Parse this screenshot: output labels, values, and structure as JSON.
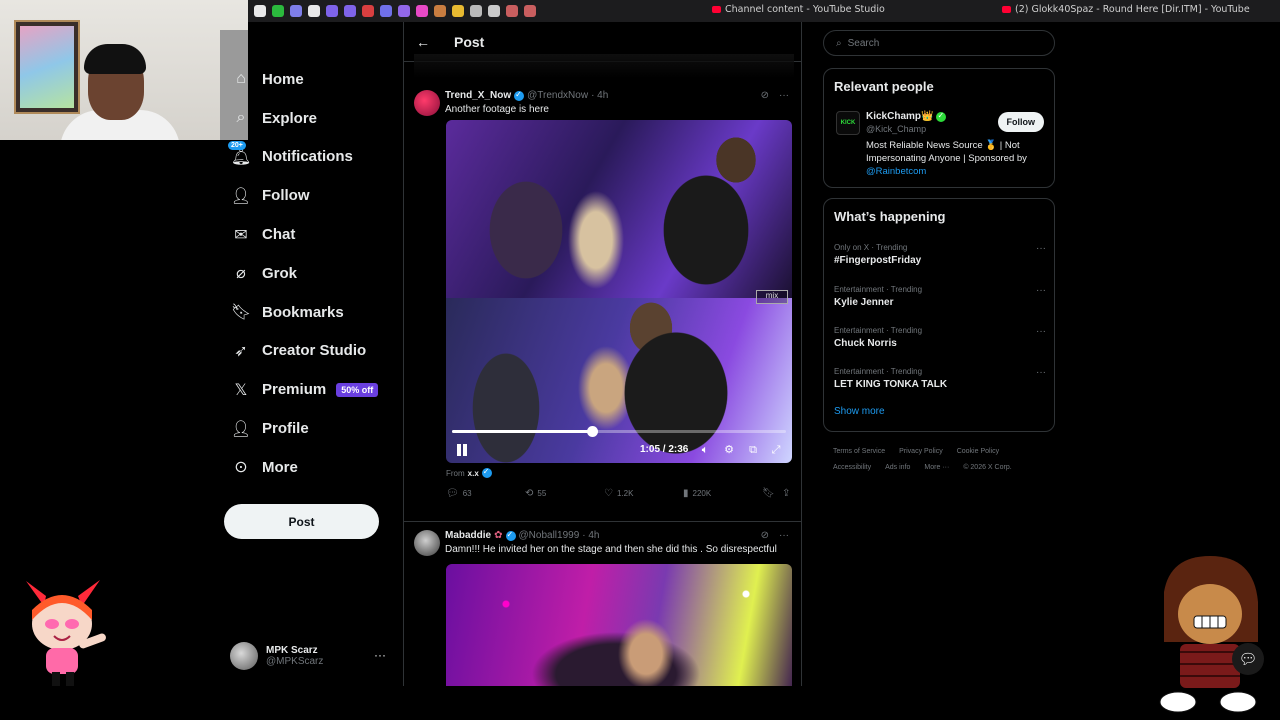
{
  "browser": {
    "tabs": [
      {
        "title": "Channel content - YouTube Studio"
      },
      {
        "title": "(2) Glokk40Spaz - Round Here [Dir.ITM] - YouTube"
      }
    ],
    "extension_colors": [
      "#ffffff",
      "#2ecc40",
      "#8a8aff",
      "#ffffff",
      "#8a6cff",
      "#8a6cff",
      "#e44",
      "#7a7aff",
      "#a070ff",
      "#ff4fd8",
      "#d84",
      "#ffcc33",
      "#ccc",
      "#ddd",
      "#d66",
      "#d66"
    ]
  },
  "sidebar": {
    "items": [
      {
        "label": "Home",
        "icon": "home-icon"
      },
      {
        "label": "Explore",
        "icon": "search-icon"
      },
      {
        "label": "Notifications",
        "icon": "bell-icon",
        "badge": "20+"
      },
      {
        "label": "Follow",
        "icon": "person-add-icon"
      },
      {
        "label": "Chat",
        "icon": "mail-icon"
      },
      {
        "label": "Grok",
        "icon": "grok-icon"
      },
      {
        "label": "Bookmarks",
        "icon": "bookmark-icon"
      },
      {
        "label": "Creator Studio",
        "icon": "rocket-icon"
      },
      {
        "label": "Premium",
        "icon": "x-logo-icon",
        "promo": "50% off"
      },
      {
        "label": "Profile",
        "icon": "person-icon"
      },
      {
        "label": "More",
        "icon": "more-circle-icon"
      }
    ],
    "post_button": "Post",
    "account": {
      "name": "MPK Scarz",
      "handle": "@MPKScarz"
    }
  },
  "main": {
    "header_title": "Post",
    "tweets": [
      {
        "name": "Trend_X_Now",
        "handle": "@TrendxNow",
        "time": "· 4h",
        "text": "Another footage is here",
        "video": {
          "elapsed": "1:05",
          "total": "2:36",
          "time_display": "1:05 / 2:36",
          "progress": 0.42
        },
        "watermark": "mix",
        "from_label": "From",
        "from_name": "x.x",
        "replies": "63",
        "reposts": "55",
        "likes": "1.2K",
        "views": "220K"
      },
      {
        "name": "Mabaddie",
        "handle": "@Noball1999",
        "time": "· 4h",
        "text": "Damn!!! He invited her on the stage and then she did this . So disrespectful"
      }
    ]
  },
  "right": {
    "search_placeholder": "Search",
    "relevant_title": "Relevant people",
    "relevant_person": {
      "avatar_text": "KICK",
      "name": "KickChamp👑",
      "handle": "@Kick_Champ",
      "follow_label": "Follow",
      "bio": "Most Reliable News Source 🥇 | Not Impersonating Anyone | Sponsored by ",
      "bio_link": "@Rainbetcom"
    },
    "happening_title": "What’s happening",
    "trends": [
      {
        "meta": "Only on X · Trending",
        "name": "#FingerpostFriday"
      },
      {
        "meta": "Entertainment · Trending",
        "name": "Kylie Jenner"
      },
      {
        "meta": "Entertainment · Trending",
        "name": "Chuck Norris"
      },
      {
        "meta": "Entertainment · Trending",
        "name": "LET KING TONKA TALK"
      }
    ],
    "show_more": "Show more",
    "footer_row1": [
      "Terms of Service",
      "Privacy Policy",
      "Cookie Policy"
    ],
    "footer_row2": [
      "Accessibility",
      "Ads info",
      "More ···",
      "© 2026 X Corp."
    ]
  },
  "colors": {
    "accent": "#1d9bf0",
    "premium": "#6a3fe0",
    "background": "#000000"
  }
}
